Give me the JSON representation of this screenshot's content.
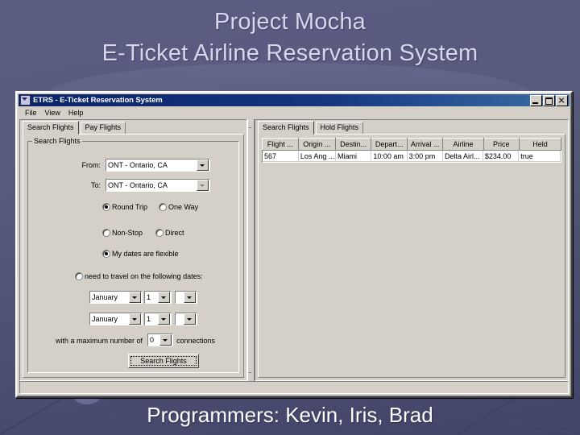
{
  "slide": {
    "title_line1": "Project Mocha",
    "title_line2": "E-Ticket Airline Reservation System",
    "footer": "Programmers: Kevin, Iris, Brad",
    "background_color": "#575a7d",
    "title_color": "#d6d7ee"
  },
  "window": {
    "title": "ETRS - E-Ticket Reservation System",
    "titlebar_color": "#0a246a",
    "icon": "app-icon",
    "controls": {
      "minimize": "minimize-button",
      "maximize": "maximize-button",
      "close": "close-button"
    },
    "menu": [
      {
        "label": "File"
      },
      {
        "label": "View"
      },
      {
        "label": "Help"
      }
    ]
  },
  "left_pane": {
    "tabs": [
      {
        "label": "Search Flights",
        "active": true
      },
      {
        "label": "Pay Flights",
        "active": false
      }
    ],
    "group_title": "Search Flights",
    "from": {
      "label": "From:",
      "value": "ONT - Ontario, CA"
    },
    "to": {
      "label": "To:",
      "value": "ONT - Ontario, CA"
    },
    "trip_type": [
      {
        "label": "Round Trip",
        "checked": true
      },
      {
        "label": "One Way",
        "checked": false
      }
    ],
    "stop_type": [
      {
        "label": "Non-Stop",
        "checked": false
      },
      {
        "label": "Direct",
        "checked": false
      }
    ],
    "date_mode": [
      {
        "label": "My dates are flexible",
        "checked": true
      },
      {
        "label": "need to travel on the following dates:",
        "checked": false
      }
    ],
    "date_rows": [
      {
        "month": "January",
        "day": "1",
        "year": ""
      },
      {
        "month": "January",
        "day": "1",
        "year": ""
      }
    ],
    "connections": {
      "prefix": "with a maximum number of",
      "value": "0",
      "suffix": "connections"
    },
    "search_button": "Search Flights"
  },
  "right_pane": {
    "tabs": [
      {
        "label": "Search Flights",
        "active": true
      },
      {
        "label": "Hold Flights",
        "active": false
      }
    ],
    "table": {
      "columns": [
        "Flight ...",
        "Origin ...",
        "Destin...",
        "Depart...",
        "Arrival ...",
        "Airline",
        "Price",
        "Held"
      ],
      "rows": [
        [
          "567",
          "Los Ang ...",
          "Miami",
          "10:00 am",
          "3:00 pm",
          "Delta Airl...",
          "$234.00",
          "true"
        ]
      ]
    }
  }
}
